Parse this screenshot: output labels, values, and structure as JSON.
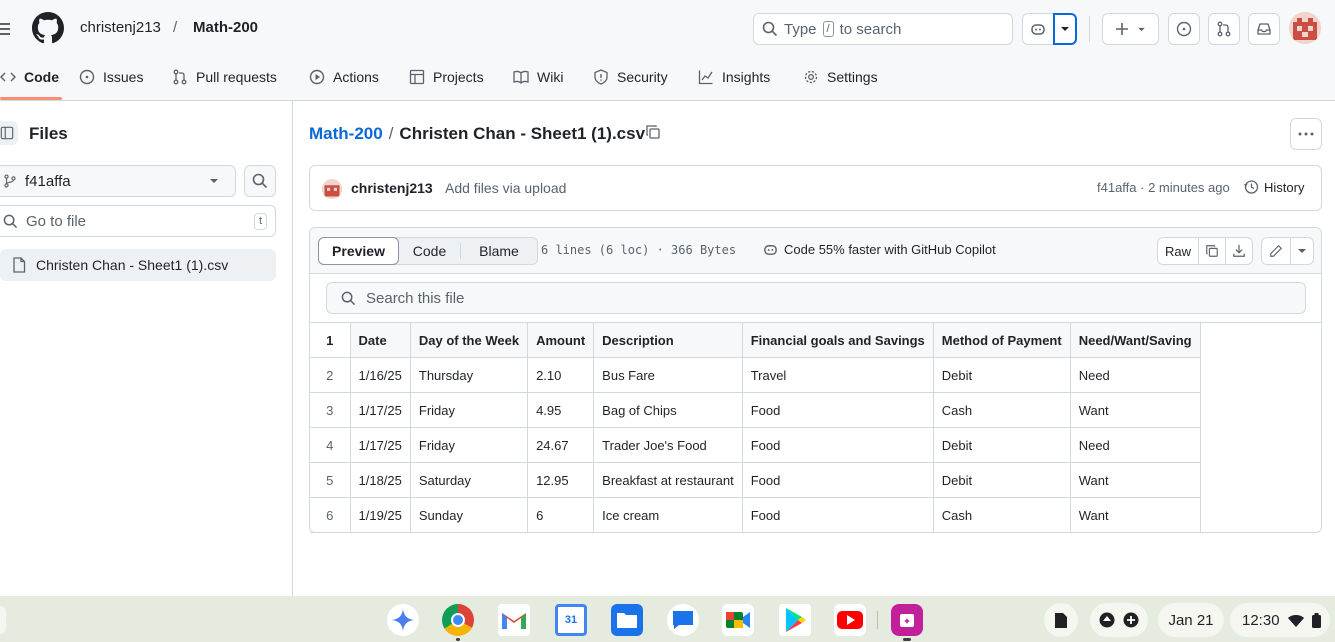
{
  "header": {
    "owner": "christenj213",
    "separator": "/",
    "repo": "Math-200",
    "search_placeholder_prefix": "Type",
    "search_key": "/",
    "search_placeholder_suffix": "to search"
  },
  "repo_tabs": [
    {
      "label": "Code",
      "icon": "code-icon"
    },
    {
      "label": "Issues",
      "icon": "issue-icon"
    },
    {
      "label": "Pull requests",
      "icon": "pull-request-icon"
    },
    {
      "label": "Actions",
      "icon": "play-icon"
    },
    {
      "label": "Projects",
      "icon": "table-icon"
    },
    {
      "label": "Wiki",
      "icon": "book-icon"
    },
    {
      "label": "Security",
      "icon": "shield-icon"
    },
    {
      "label": "Insights",
      "icon": "graph-icon"
    },
    {
      "label": "Settings",
      "icon": "gear-icon"
    }
  ],
  "sidebar": {
    "title": "Files",
    "branch": "f41affa",
    "goto_placeholder": "Go to file",
    "goto_key": "t",
    "files": [
      "Christen Chan - Sheet1 (1).csv"
    ]
  },
  "breadcrumb": {
    "repo": "Math-200",
    "separator": "/",
    "file": "Christen Chan - Sheet1 (1).csv"
  },
  "commit": {
    "author": "christenj213",
    "message": "Add files via upload",
    "sha_time": "f41affa · 2 minutes ago",
    "history_label": "History"
  },
  "file_toolbar": {
    "views": [
      "Preview",
      "Code",
      "Blame"
    ],
    "active_view": "Preview",
    "info": "6 lines (6 loc) · 366 Bytes",
    "copilot": "Code 55% faster with GitHub Copilot",
    "raw_label": "Raw",
    "search_placeholder": "Search this file"
  },
  "csv": {
    "header_line": "1",
    "columns": [
      "Date",
      "Day of the Week",
      "Amount",
      "Description",
      "Financial goals and Savings",
      "Method of Payment",
      "Need/Want/Saving"
    ],
    "rows": [
      {
        "line": "2",
        "cells": [
          "1/16/25",
          "Thursday",
          "2.10",
          "Bus Fare",
          "Travel",
          "Debit",
          "Need"
        ]
      },
      {
        "line": "3",
        "cells": [
          "1/17/25",
          "Friday",
          "4.95",
          "Bag of Chips",
          "Food",
          "Cash",
          "Want"
        ]
      },
      {
        "line": "4",
        "cells": [
          "1/17/25",
          "Friday",
          "24.67",
          "Trader Joe's Food",
          "Food",
          "Debit",
          "Need"
        ]
      },
      {
        "line": "5",
        "cells": [
          "1/18/25",
          "Saturday",
          "12.95",
          "Breakfast at restaurant",
          "Food",
          "Debit",
          "Want"
        ]
      },
      {
        "line": "6",
        "cells": [
          "1/19/25",
          "Sunday",
          "6",
          "Ice cream",
          "Food",
          "Cash",
          "Want"
        ]
      }
    ]
  },
  "taskbar": {
    "calendar_day": "31",
    "date": "Jan 21",
    "time": "12:30"
  },
  "colors": {
    "accent": "#0969da",
    "tab_underline": "#fd8c73",
    "border": "#d1d9e0"
  }
}
